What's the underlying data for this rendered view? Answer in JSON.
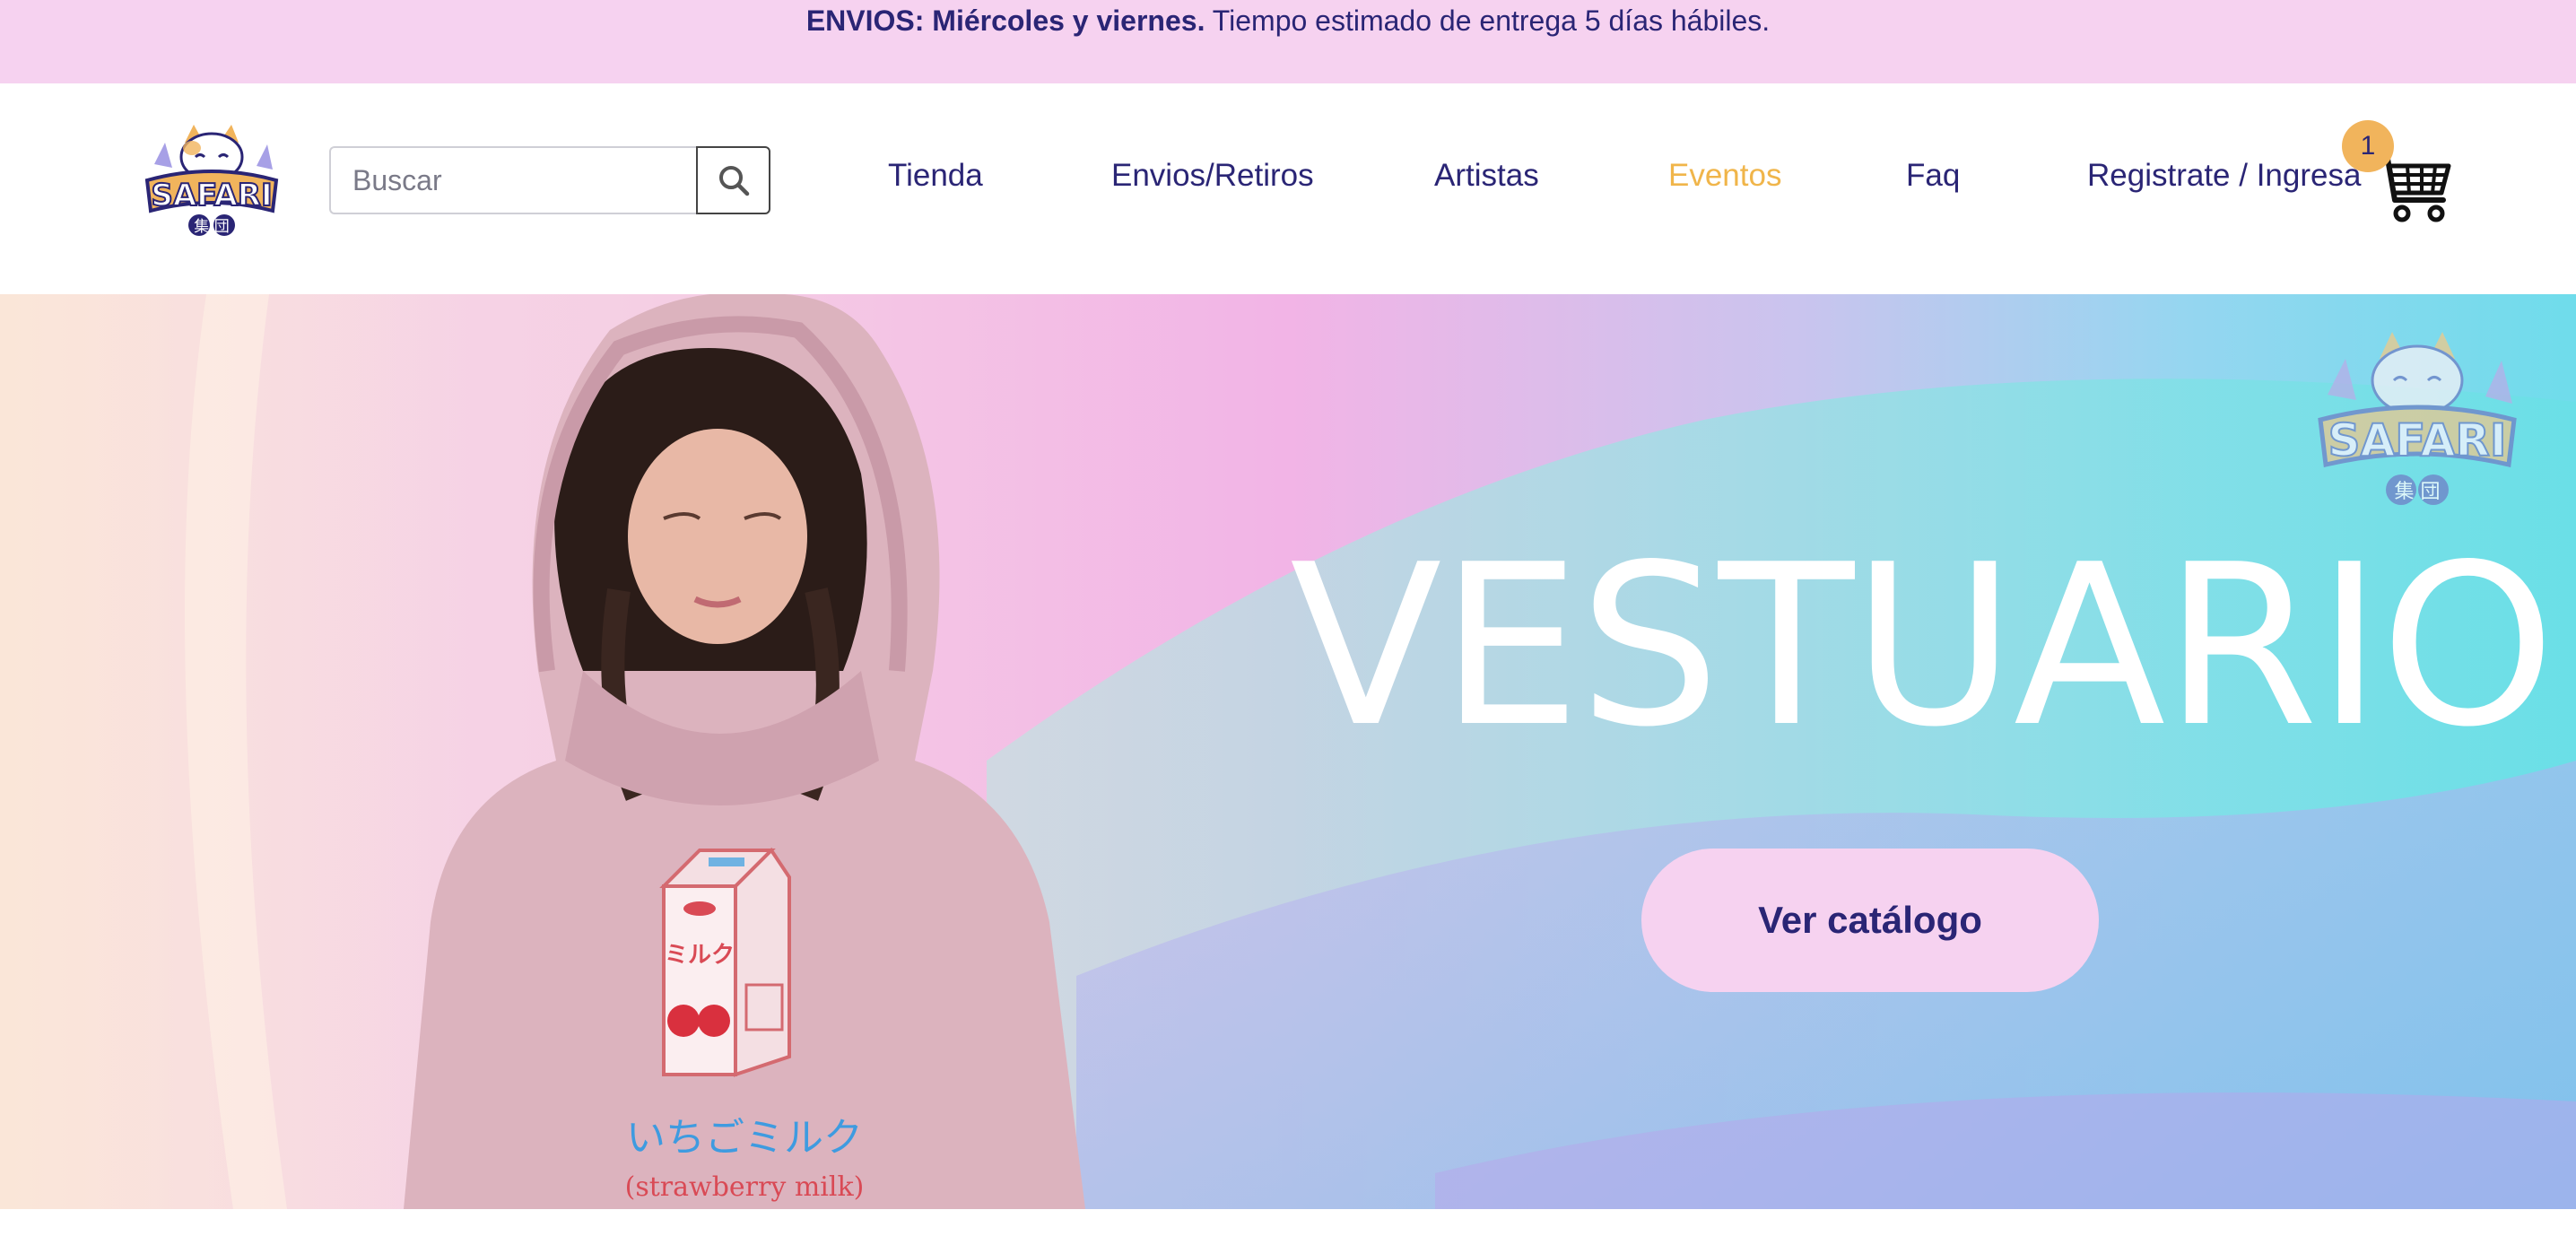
{
  "announcement": {
    "bold": "ENVIOS: Miércoles y viernes.",
    "text": " Tiempo estimado de entrega 5 días hábiles."
  },
  "header": {
    "logo_text": "SAFARI",
    "logo_subtext": "集 団",
    "search": {
      "placeholder": "Buscar",
      "value": "",
      "icon": "search-icon"
    },
    "nav": [
      {
        "label": "Tienda",
        "active": false
      },
      {
        "label": "Envios/Retiros",
        "active": false
      },
      {
        "label": "Artistas",
        "active": false
      },
      {
        "label": "Eventos",
        "active": true
      },
      {
        "label": "Faq",
        "active": false
      },
      {
        "label": "Registrate / Ingresa",
        "active": false
      }
    ],
    "cart": {
      "icon": "cart-icon",
      "count": "1"
    }
  },
  "hero": {
    "title": "VESTUARIO",
    "cta_label": "Ver catálogo",
    "badge_text": "SAFARI",
    "badge_subtext": "集 団",
    "hoodie_print_jp": "いちごミルク",
    "hoodie_print_en": "(strawberry milk)",
    "carton_text": "ミルク"
  },
  "colors": {
    "brand_navy": "#2a2575",
    "accent_orange": "#f0b54a",
    "announce_bg": "#f6d2f0",
    "badge_orange": "#f1b45c"
  }
}
